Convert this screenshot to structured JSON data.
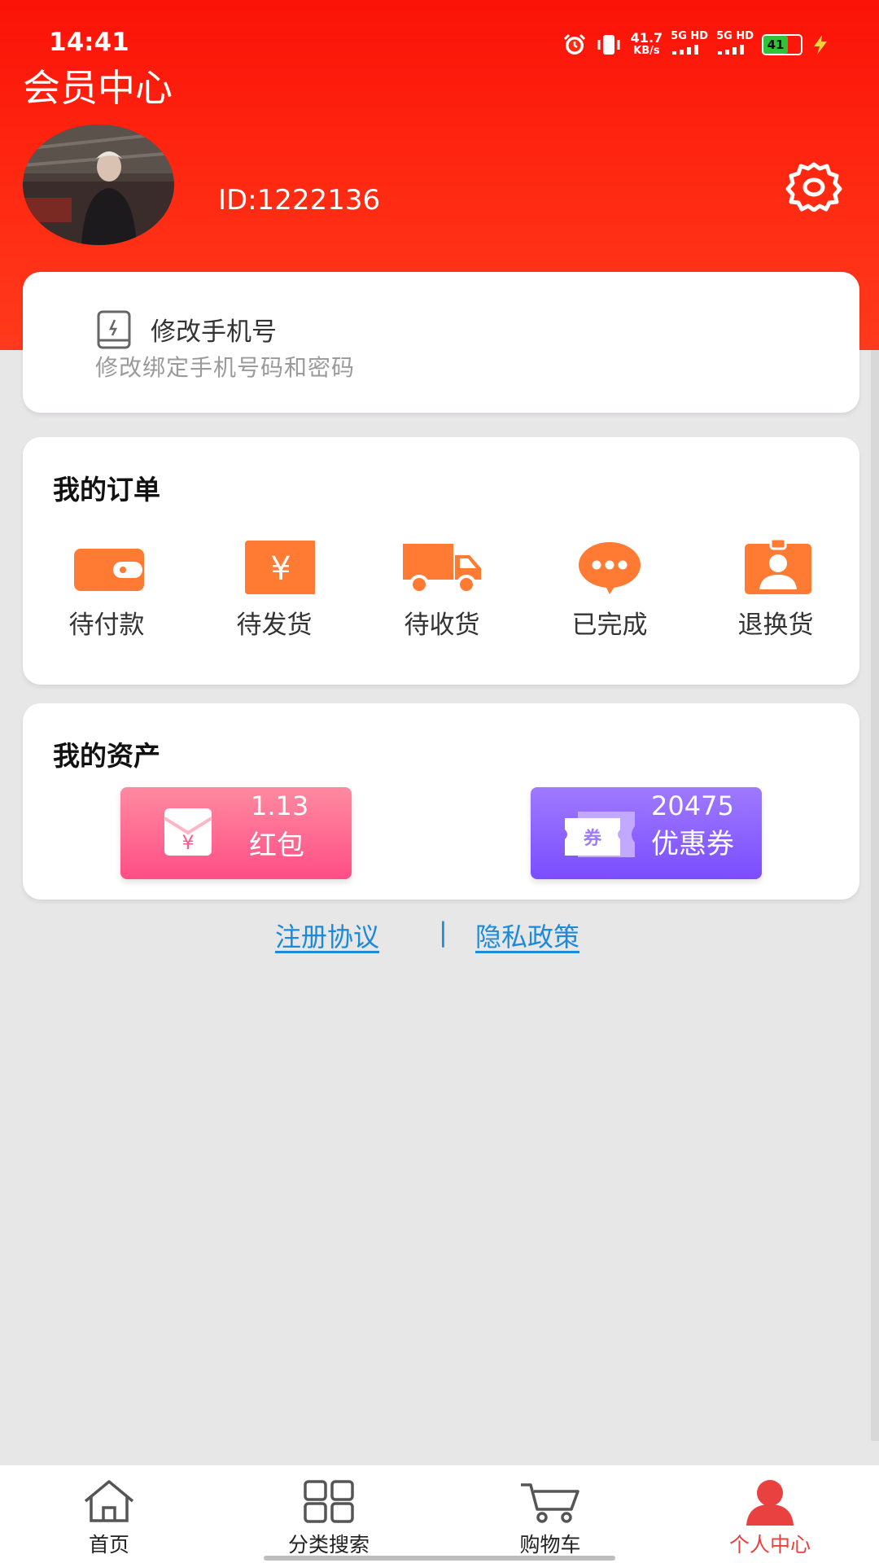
{
  "status_bar": {
    "time": "14:41",
    "net_speed_value": "41.7",
    "net_speed_unit": "KB/s",
    "signal1": "5G HD",
    "signal2": "5G HD",
    "battery": "41"
  },
  "header": {
    "title": "会员中心",
    "member_id": "ID:1222136"
  },
  "phone_card": {
    "title": "修改手机号",
    "subtitle": "修改绑定手机号码和密码"
  },
  "orders": {
    "title": "我的订单",
    "items": [
      {
        "label": "待付款",
        "icon": "wallet-icon"
      },
      {
        "label": "待发货",
        "icon": "yuan-box-icon"
      },
      {
        "label": "待收货",
        "icon": "truck-icon"
      },
      {
        "label": "已完成",
        "icon": "chat-bubble-icon"
      },
      {
        "label": "退换货",
        "icon": "id-badge-icon"
      }
    ]
  },
  "assets": {
    "title": "我的资产",
    "hongbao_value": "1.13",
    "hongbao_label": "红包",
    "coupon_value": "20475",
    "coupon_label": "优惠券",
    "coupon_icon_text": "券",
    "yuan_symbol": "¥"
  },
  "links": {
    "register": "注册协议",
    "separator": "|",
    "privacy": "隐私政策"
  },
  "bottom_nav": {
    "items": [
      {
        "label": "首页"
      },
      {
        "label": "分类搜索"
      },
      {
        "label": "购物车"
      },
      {
        "label": "个人中心"
      }
    ],
    "active_index": 3
  },
  "colors": {
    "header_red": "#fb1208",
    "icon_orange": "#ff7a32",
    "link_blue": "#1b8ad8",
    "active_tab": "#e8413f"
  }
}
